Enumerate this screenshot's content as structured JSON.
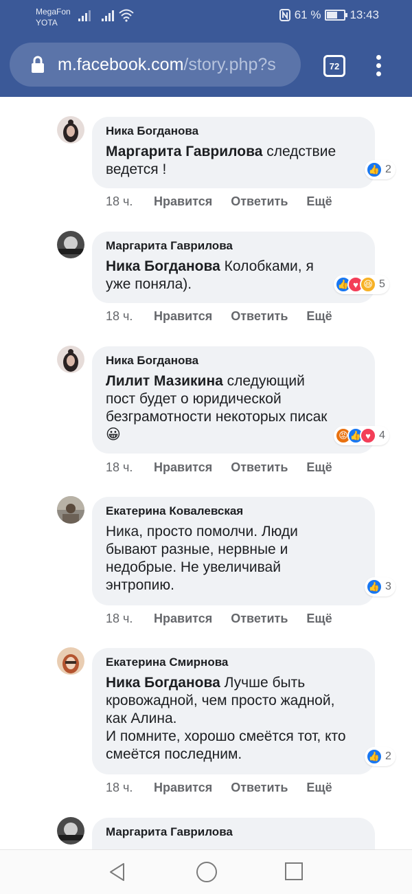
{
  "status_bar": {
    "carrier1": "MegaFon",
    "carrier2": "YOTA",
    "battery": "61 %",
    "battery_level": 0.61,
    "time": "13:43"
  },
  "browser": {
    "url_host": "m.facebook.com",
    "url_path": "/story.php?s",
    "tab_count": "72"
  },
  "colors": {
    "header": "#3b5998",
    "bubble": "#f0f2f5",
    "like": "#1877f2"
  },
  "comments": [
    {
      "author": "Ника Богданова",
      "mention": "Маргарита Гаврилова",
      "text": " следствие ведется !",
      "time": "18 ч.",
      "reactions": [
        "like"
      ],
      "count": "2"
    },
    {
      "author": "Маргарита Гаврилова",
      "mention": "Ника Богданова",
      "text": " Колобками, я уже поняла).",
      "time": "18 ч.",
      "reactions": [
        "like",
        "love",
        "haha"
      ],
      "count": "5"
    },
    {
      "author": "Ника Богданова",
      "mention": "Лилит Мазикина",
      "text": " следующий пост будет о юридической безграмотности некоторых писак 😀",
      "time": "18 ч.",
      "reactions": [
        "angry",
        "like",
        "love"
      ],
      "count": "4"
    },
    {
      "author": "Екатерина Ковалевская",
      "mention": "",
      "text": "Ника, просто помолчи. Люди бывают разные, нервные и недобрые. Не увеличивай энтропию.",
      "time": "18 ч.",
      "reactions": [
        "like"
      ],
      "count": "3"
    },
    {
      "author": "Екатерина Смирнова",
      "mention": "Ника Богданова",
      "text": " Лучше быть кровожадной, чем просто жадной, как Алина.\nИ помните, хорошо смеётся тот, кто смеётся последним.",
      "time": "18 ч.",
      "reactions": [
        "like"
      ],
      "count": "2"
    },
    {
      "author": "Маргарита Гаврилова"
    }
  ],
  "actions": {
    "like": "Нравится",
    "reply": "Ответить",
    "more": "Ещё"
  }
}
